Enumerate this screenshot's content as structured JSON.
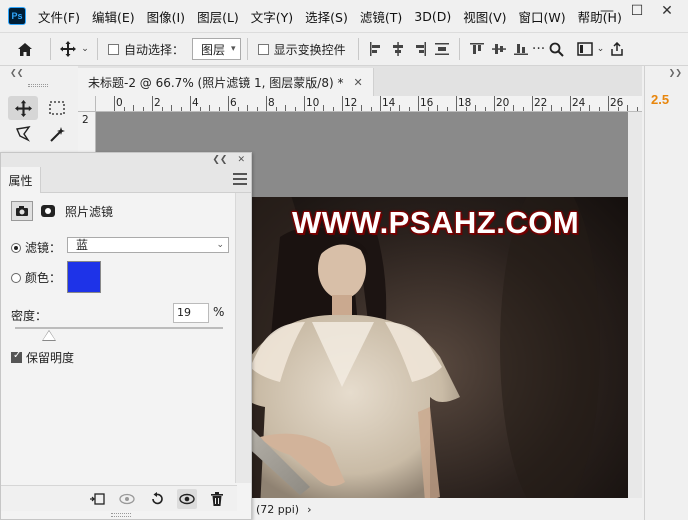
{
  "menubar": {
    "logo": "Ps",
    "items": [
      "文件(F)",
      "编辑(E)",
      "图像(I)",
      "图层(L)",
      "文字(Y)",
      "选择(S)",
      "滤镜(T)",
      "3D(D)",
      "视图(V)",
      "窗口(W)",
      "帮助(H)"
    ],
    "window_controls": [
      "—",
      "☐",
      "✕"
    ]
  },
  "options_bar": {
    "auto_select_label": "自动选择：",
    "auto_select_target": "图层",
    "show_transform_label": "显示变换控件"
  },
  "document": {
    "tab_title": "未标题-2 @ 66.7% (照片滤镜 1, 图层蒙版/8) *",
    "close_glyph": "✕",
    "ruler_h": [
      "0",
      "2",
      "4",
      "6",
      "8",
      "10",
      "12",
      "14",
      "16",
      "18",
      "20",
      "22",
      "24",
      "26"
    ],
    "ruler_v": [
      "2"
    ],
    "status": "(72 ppi)",
    "status_arrow": "›",
    "watermark": "WWW.PSAHZ.COM"
  },
  "right_panel": {
    "version": "2.5"
  },
  "properties": {
    "tab_label": "属性",
    "adjustment_name": "照片滤镜",
    "filter_label": "滤镜：",
    "filter_value": "蓝",
    "color_label": "颜色：",
    "color_value": "#1e33e8",
    "density_label": "密度：",
    "density_value": "19",
    "density_unit": "%",
    "density_percent": 19,
    "preserve_luminosity_label": "保留明度",
    "preserve_luminosity_checked": true,
    "filter_selected": true
  },
  "colors": {
    "accent_orange": "#e8860c",
    "filter_swatch": "#1e33e8",
    "watermark_stroke": "#6b0000"
  }
}
